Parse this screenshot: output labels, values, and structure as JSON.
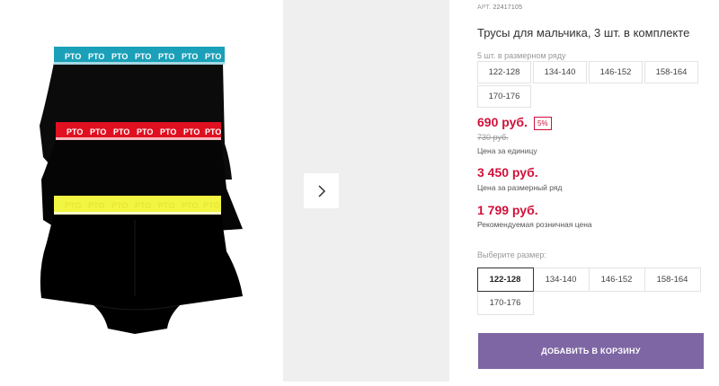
{
  "product": {
    "article_label": "АРТ.",
    "article_number": "22417105",
    "title": "Трусы для мальчика, 3 шт. в комплекте",
    "brand_print": "PTO"
  },
  "size_range": {
    "caption": "5 шт. в размерном ряду",
    "sizes": [
      "122-128",
      "134-140",
      "146-152",
      "158-164",
      "170-176"
    ]
  },
  "prices": {
    "unit_price": "690 руб.",
    "discount": "5%",
    "old_price": "730 руб.",
    "unit_note": "Цена за единицу",
    "range_price": "3 450 руб.",
    "range_note": "Цена за размерный ряд",
    "retail_price": "1 799 руб.",
    "retail_note": "Рекомендуемая розничная цена"
  },
  "size_select": {
    "caption": "Выберите размер:",
    "sizes": [
      "122-128",
      "134-140",
      "146-152",
      "158-164",
      "170-176"
    ],
    "selected": "122-128"
  },
  "cart": {
    "button_label": "ДОБАВИТЬ В КОРЗИНУ"
  },
  "colors": {
    "accent": "#7e66a4",
    "price_red": "#d0103a",
    "band_teal": "#1aa0b8",
    "band_red": "#e01020",
    "band_yellow": "#f2f542"
  },
  "icons": {
    "next": "chevron-right-icon"
  }
}
